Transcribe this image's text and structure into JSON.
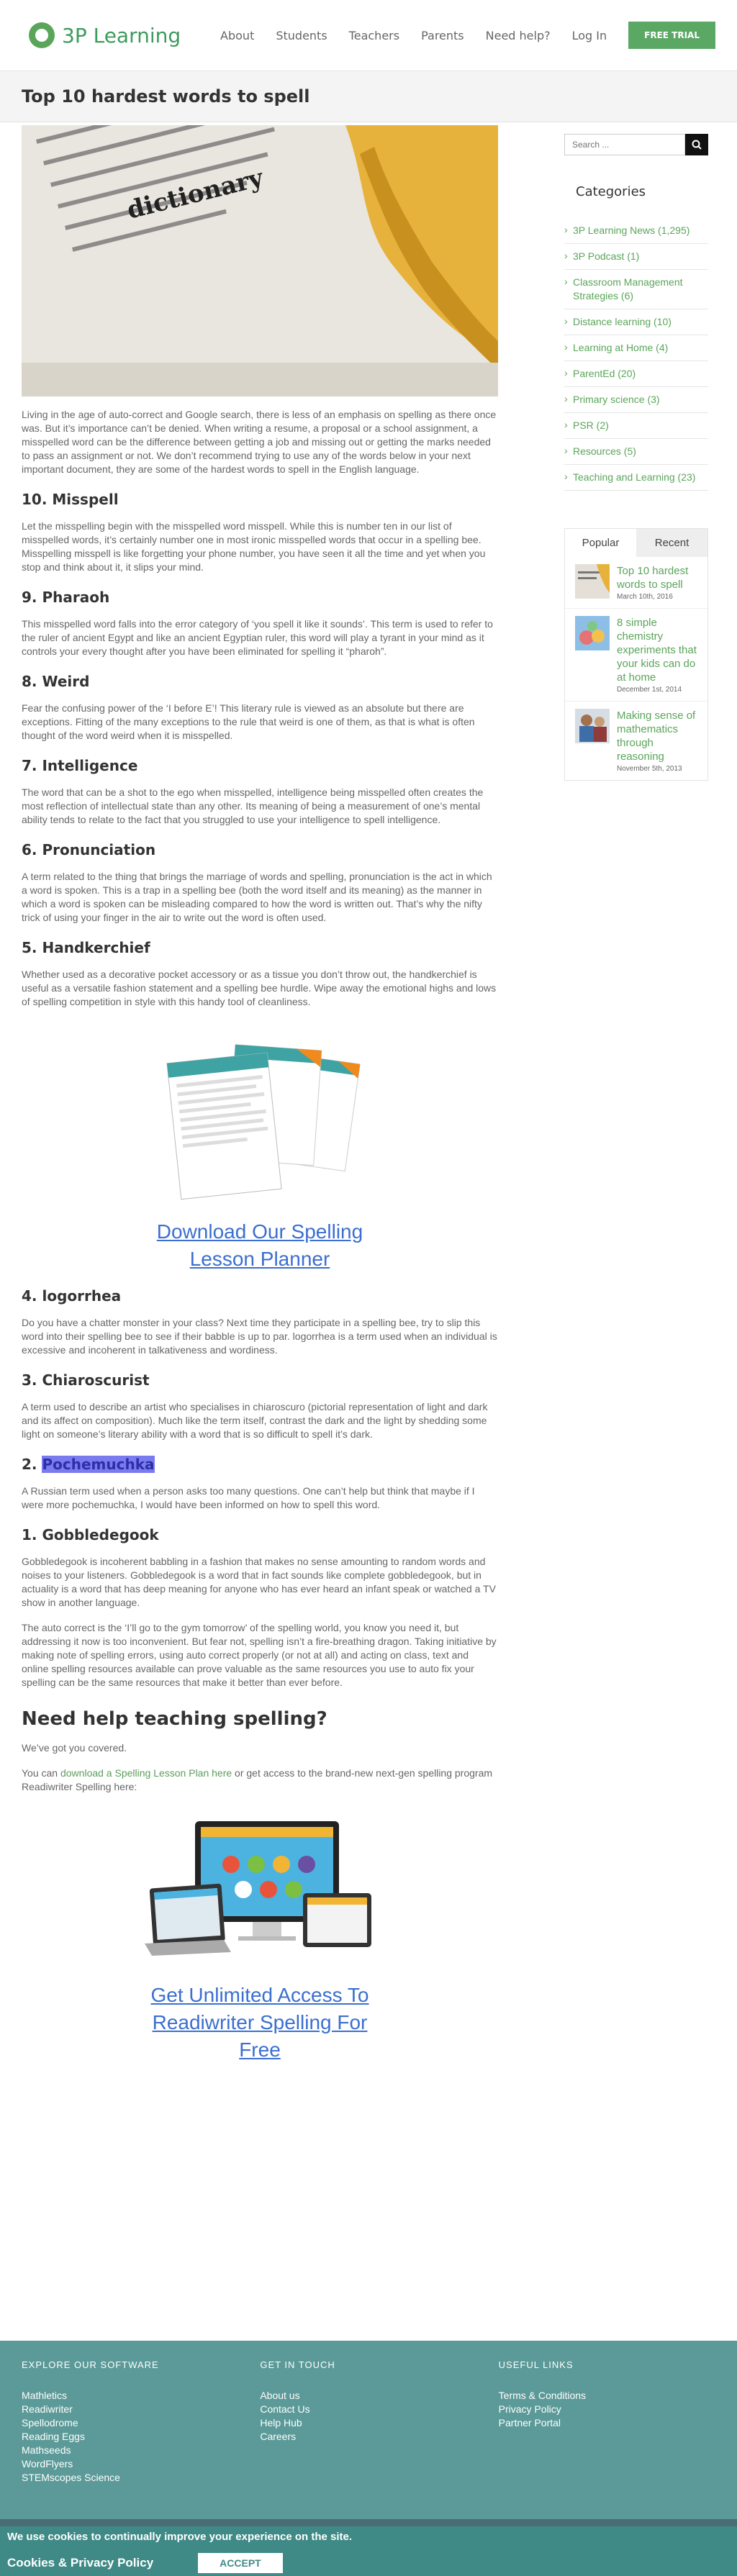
{
  "header": {
    "logo_text": "3P Learning",
    "nav": [
      "About",
      "Students",
      "Teachers",
      "Parents",
      "Need help?",
      "Log In"
    ],
    "trial": "FREE TRIAL"
  },
  "page_title": "Top 10 hardest words to spell",
  "article": {
    "intro": "Living in the age of auto-correct and Google search, there is less of an emphasis on spelling as there once was. But it’s importance can’t be denied. When writing a resume, a proposal or a school assignment, a misspelled word can be the difference between getting a job and missing out or getting the marks needed to pass an assignment or not. We don’t recommend trying to use any of the words below in your next important document, they are some of the hardest words to spell in the English language.",
    "h10": "10. Misspell",
    "p10": "Let the misspelling begin with the misspelled word misspell. While this is number ten in our list of misspelled words, it’s certainly number one in most ironic misspelled words that occur in a spelling bee. Misspelling misspell is like forgetting your phone number, you have seen it all the time and yet when you stop and think about it, it slips your mind.",
    "h9": "9. Pharaoh",
    "p9": "This misspelled word falls into the error category of ‘you spell it like it sounds’. This term is used to refer to the ruler of ancient Egypt and like an ancient Egyptian ruler, this word will play a tyrant in your mind as it controls your every thought after you have been eliminated for spelling it “pharoh”.",
    "h8": " 8. Weird",
    "p8": "Fear the confusing power of the ‘I before E’! This literary rule is viewed as an absolute but there are exceptions. Fitting of the many exceptions to the rule that weird is one of them, as that is what is often thought of the word weird when it is misspelled.",
    "h7": "7. Intelligence",
    "p7": "The word that can be a shot to the ego when misspelled, intelligence being misspelled often creates the most reflection of intellectual state than any other. Its meaning of being a measurement of one’s mental ability tends to relate to the fact that you struggled to use your intelligence to spell intelligence.",
    "h6": "6. Pronunciation",
    "p6": "A term related to the thing that brings the marriage of words and spelling, pronunciation is the act in which a word is spoken. This is a trap in a spelling bee (both the word itself and its meaning) as the manner in which a word is spoken can be misleading compared to how the word is written out. That’s why the nifty trick of using your finger in the air to write out the word is often used.",
    "h5": "5. Handkerchief",
    "p5": "Whether used as a decorative pocket accessory or as a tissue you don’t throw out, the handkerchief is useful as a versatile fashion statement and a spelling bee hurdle. Wipe away the emotional highs and lows of spelling competition in style with this handy tool of cleanliness.",
    "promo1": "Download Our Spelling Lesson Planner",
    "h4": "4. logorrhea",
    "p4": "Do you have a chatter monster in your class? Next time they participate in a spelling bee, try to slip this word into their spelling bee to see if their babble is up to par. logorrhea is a term used when an individual is excessive and incoherent in talkativeness and wordiness.",
    "h3": "3. Chiaroscurist",
    "p3": "A term used to describe an artist who specialises in chiaroscuro (pictorial representation of light and dark and its affect on composition). Much like the term itself, contrast the dark and the light by shedding some light on someone’s literary ability with a word that is so difficult to spell it’s dark.",
    "h2num": "2. ",
    "h2word": "Pochemuchka",
    "p2": "A Russian term used when a person asks too many questions. One can’t help but think that maybe if I were more pochemuchka, I would have been informed on how to spell this word.",
    "h1": "1. Gobbledegook",
    "p1": "Gobbledegook is incoherent babbling in a fashion that makes no sense amounting to random words and noises to your listeners. Gobbledegook is a word that in fact sounds like complete gobbledegook, but in actuality is a word that has deep meaning for anyone who has ever heard an infant speak or watched a TV show in another language.",
    "outro": "The auto correct is the ‘I’ll go to the gym tomorrow’ of the spelling world, you know you need it, but addressing it now is too inconvenient. But fear not, spelling isn’t a fire-breathing dragon. Taking initiative by making note of spelling errors, using auto correct properly (or not at all) and acting on class, text and online spelling resources available can prove valuable as the same resources you use to auto fix your spelling can be the same resources that make it better than ever before.",
    "help_h": "Need help teaching spelling?",
    "help_p1": "We’ve got you covered.",
    "help_p2_a": "You can ",
    "help_link": "download a Spelling Lesson Plan here",
    "help_p2_b": " or get access to the brand-new next-gen spelling program Readiwriter Spelling here:",
    "promo2": "Get Unlimited Access To Readiwriter Spelling For Free"
  },
  "sidebar": {
    "search_placeholder": "Search ...",
    "categories_title": "Categories",
    "categories": [
      "3P Learning News (1,295)",
      "3P Podcast (1)",
      "Classroom Management Strategies (6)",
      "Distance learning (10)",
      "Learning at Home (4)",
      "ParentEd (20)",
      "Primary science (3)",
      "PSR (2)",
      "Resources (5)",
      "Teaching and Learning (23)"
    ],
    "tab_popular": "Popular",
    "tab_recent": "Recent",
    "posts": [
      {
        "title": "Top 10 hardest words to spell",
        "date": "March 10th, 2016"
      },
      {
        "title": "8 simple chemistry experiments that your kids can do at home",
        "date": "December 1st, 2014"
      },
      {
        "title": "Making sense of mathematics through reasoning",
        "date": "November 5th, 2013"
      }
    ]
  },
  "footer": {
    "col1_title": "EXPLORE OUR SOFTWARE",
    "col1": [
      "Mathletics",
      "Readiwriter",
      "Spellodrome",
      "Reading Eggs",
      "Mathseeds",
      "WordFlyers",
      "STEMscopes Science"
    ],
    "col2_title": "GET IN TOUCH",
    "col2": [
      "About us",
      "Contact Us",
      "Help Hub",
      "Careers"
    ],
    "col3_title": "USEFUL LINKS",
    "col3": [
      "Terms & Conditions",
      "Privacy Policy",
      "Partner Portal"
    ]
  },
  "cookie": {
    "text": "We use cookies to continually improve your experience on the site.",
    "policy": "Cookies & Privacy Policy",
    "accept": "ACCEPT"
  }
}
